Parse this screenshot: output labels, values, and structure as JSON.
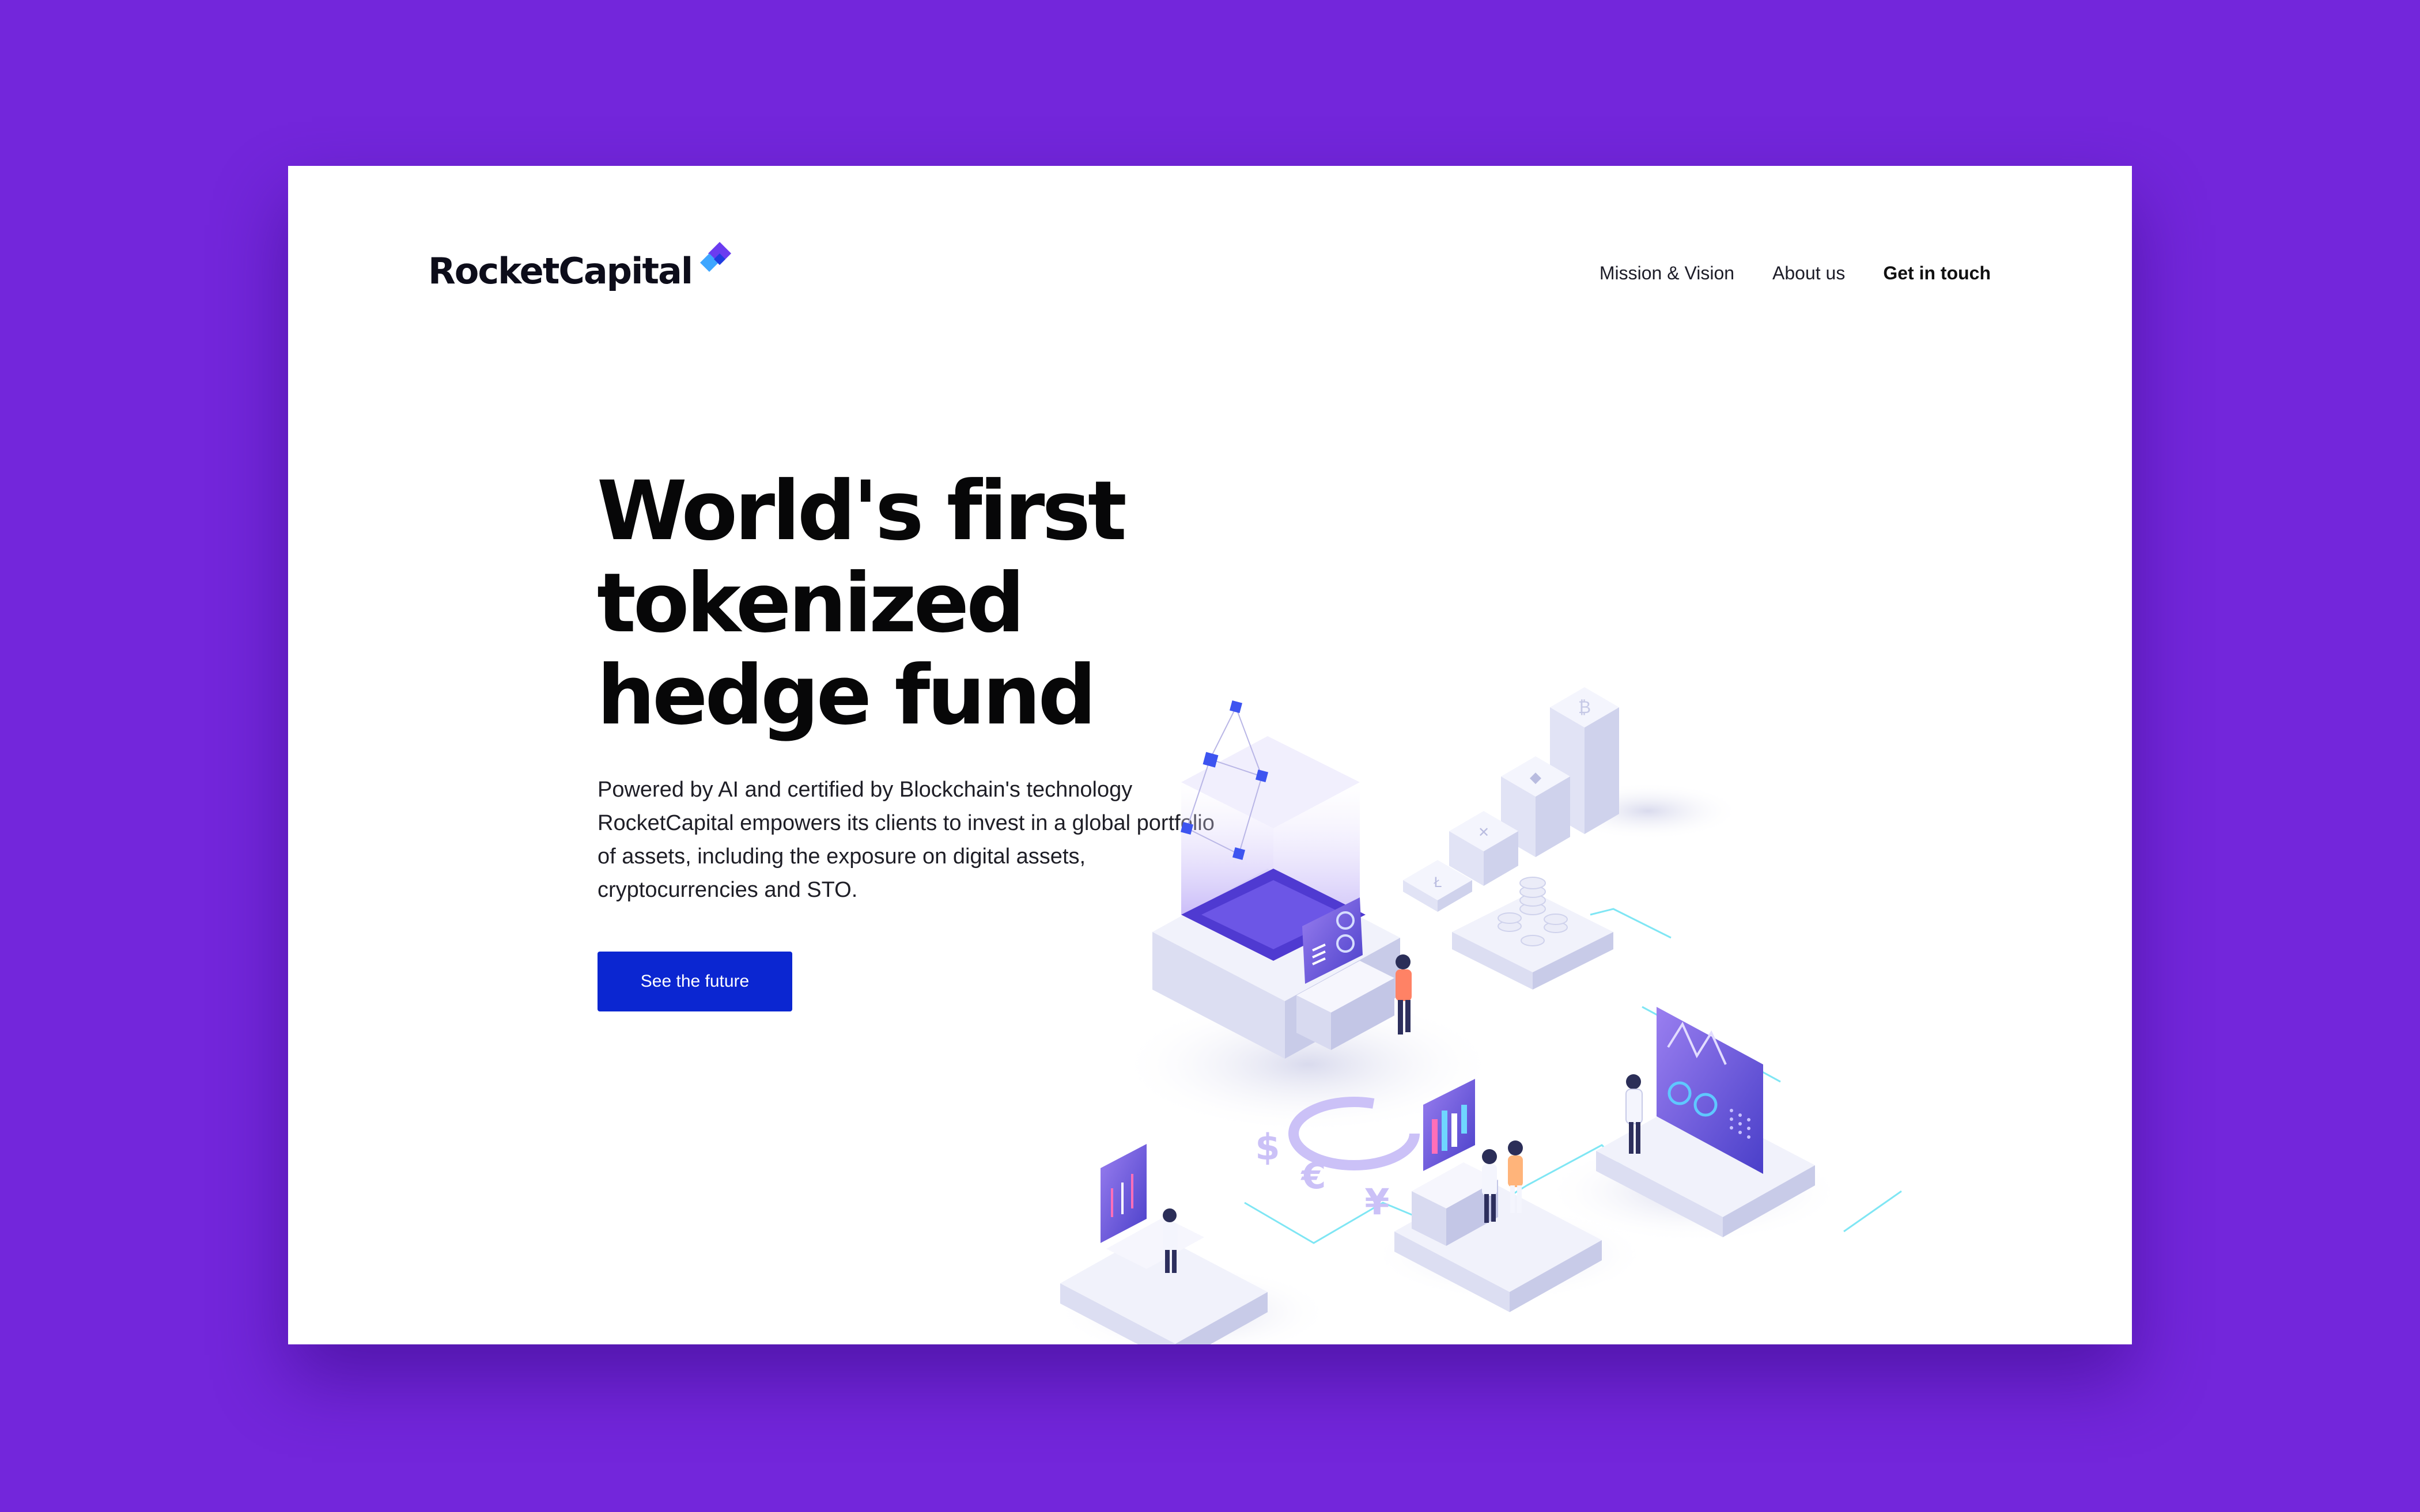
{
  "brand": {
    "name": "RocketCapital"
  },
  "nav": {
    "items": [
      {
        "label": "Mission & Vision"
      },
      {
        "label": "About us"
      },
      {
        "label": "Get in touch"
      }
    ]
  },
  "hero": {
    "title_lines": [
      "World's first",
      "tokenized",
      "hedge fund"
    ],
    "description": "Powered by AI and certified by Blockchain's technology RocketCapital empowers its clients to invest in a global portfolio of assets, including the exposure on digital assets, cryptocurrencies and STO.",
    "cta_label": "See the future"
  },
  "illustration": {
    "currency_symbols": [
      "$",
      "€",
      "¥"
    ],
    "icons": [
      "bitcoin-icon",
      "ethereum-icon",
      "ripple-icon",
      "litecoin-icon",
      "apple-icon"
    ]
  },
  "colors": {
    "background": "#7326db",
    "card": "#ffffff",
    "button": "#0b26d1",
    "accent_violet": "#6e4fe6",
    "accent_blue": "#3d54f0",
    "platform": "#e7e8f6",
    "connector": "#7fe6f4"
  }
}
